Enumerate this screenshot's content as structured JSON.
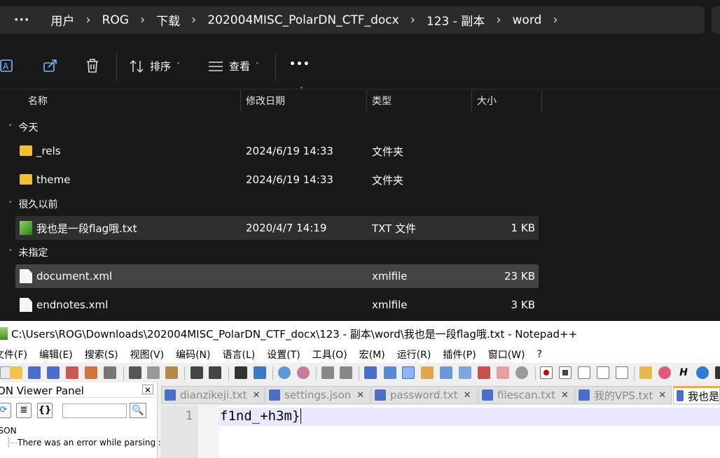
{
  "explorer": {
    "breadcrumbs": [
      "用户",
      "ROG",
      "下载",
      "202004MISC_PolarDN_CTF_docx",
      "123 - 副本",
      "word"
    ],
    "toolbar": {
      "sort_label": "排序",
      "view_label": "查看",
      "more_label": "•••"
    },
    "columns": {
      "name": "名称",
      "date": "修改日期",
      "type": "类型",
      "size": "大小"
    },
    "groups": [
      {
        "label": "今天"
      },
      {
        "label": "很久以前"
      },
      {
        "label": "未指定"
      }
    ],
    "files": [
      {
        "name": "_rels",
        "date": "2024/6/19 14:33",
        "type": "文件夹",
        "size": ""
      },
      {
        "name": "theme",
        "date": "2024/6/19 14:33",
        "type": "文件夹",
        "size": ""
      },
      {
        "name": "我也是一段flag哦.txt",
        "date": "2020/4/7 14:19",
        "type": "TXT 文件",
        "size": "1 KB"
      },
      {
        "name": "document.xml",
        "date": "",
        "type": "xmlfile",
        "size": "23 KB"
      },
      {
        "name": "endnotes.xml",
        "date": "",
        "type": "xmlfile",
        "size": "3 KB"
      }
    ]
  },
  "npp": {
    "title": "C:\\Users\\ROG\\Downloads\\202004MISC_PolarDN_CTF_docx\\123 - 副本\\word\\我也是一段flag哦.txt - Notepad++",
    "menu": [
      "文件(F)",
      "编辑(E)",
      "搜索(S)",
      "视图(V)",
      "编码(N)",
      "语言(L)",
      "设置(T)",
      "工具(O)",
      "宏(M)",
      "运行(R)",
      "插件(P)",
      "窗口(W)",
      "?"
    ],
    "json_panel": {
      "title": "JSON Viewer Panel",
      "close": "✕",
      "tree_root": "JSON",
      "tree_child": "There was an error while parsing :"
    },
    "tabs": [
      {
        "label": "dianzikeji.txt",
        "close": "✕"
      },
      {
        "label": "settings.json",
        "close": "✕"
      },
      {
        "label": "password.txt",
        "close": "✕"
      },
      {
        "label": "filescan.txt",
        "close": "✕"
      },
      {
        "label": "我的VPS.txt",
        "close": "✕"
      },
      {
        "label": "我也是",
        "close": ""
      }
    ],
    "editor": {
      "line_number": "1",
      "content": "f1nd_+h3m}"
    }
  }
}
